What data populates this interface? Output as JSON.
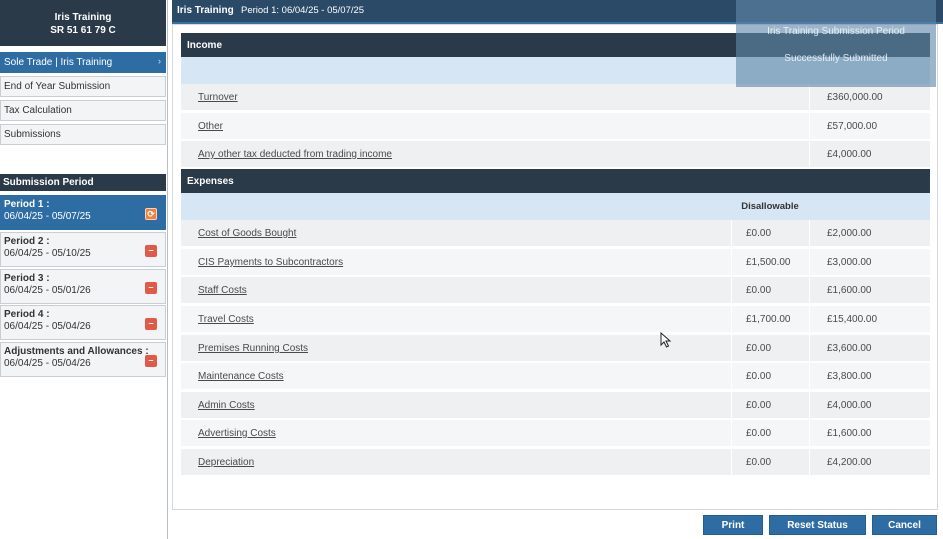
{
  "client": {
    "name": "Iris Training",
    "utr": "SR 51 61 79 C"
  },
  "nav": {
    "items": [
      {
        "label": "Sole Trade | Iris Training",
        "active": true
      },
      {
        "label": "End of Year Submission",
        "active": false
      },
      {
        "label": "Tax Calculation",
        "active": false
      },
      {
        "label": "Submissions",
        "active": false
      }
    ]
  },
  "submission_period": {
    "header": "Submission Period",
    "periods": [
      {
        "name": "Period 1 :",
        "dates": "06/04/25  -  05/07/25",
        "active": true
      },
      {
        "name": "Period 2 :",
        "dates": "06/04/25  -  05/10/25",
        "active": false
      },
      {
        "name": "Period 3 :",
        "dates": "06/04/25  -  05/01/26",
        "active": false
      },
      {
        "name": "Period 4 :",
        "dates": "06/04/25  -  05/04/26",
        "active": false
      },
      {
        "name": "Adjustments and Allowances :",
        "dates": "06/04/25  -  05/04/26",
        "active": false
      }
    ]
  },
  "topbar": {
    "org": "Iris Training",
    "period_label": "Period 1: 06/04/25 - 05/07/25"
  },
  "toast": {
    "line1": "Iris Training Submission Period",
    "line2": "Successfully Submitted"
  },
  "income": {
    "header": "Income",
    "rows": [
      {
        "label": "Turnover",
        "amount": "£360,000.00"
      },
      {
        "label": "Other",
        "amount": "£57,000.00"
      },
      {
        "label": "Any other tax deducted from trading income",
        "amount": "£4,000.00"
      }
    ]
  },
  "expenses": {
    "header": "Expenses",
    "disallowable_label": "Disallowable",
    "rows": [
      {
        "label": "Cost of Goods Bought",
        "disallowable": "£0.00",
        "amount": "£2,000.00"
      },
      {
        "label": "CIS Payments to Subcontractors",
        "disallowable": "£1,500.00",
        "amount": "£3,000.00"
      },
      {
        "label": "Staff Costs",
        "disallowable": "£0.00",
        "amount": "£1,600.00"
      },
      {
        "label": "Travel Costs",
        "disallowable": "£1,700.00",
        "amount": "£15,400.00"
      },
      {
        "label": "Premises Running Costs",
        "disallowable": "£0.00",
        "amount": "£3,600.00"
      },
      {
        "label": "Maintenance Costs",
        "disallowable": "£0.00",
        "amount": "£3,800.00"
      },
      {
        "label": "Admin Costs",
        "disallowable": "£0.00",
        "amount": "£4,000.00"
      },
      {
        "label": "Advertising Costs",
        "disallowable": "£0.00",
        "amount": "£1,600.00"
      },
      {
        "label": "Depreciation",
        "disallowable": "£0.00",
        "amount": "£4,200.00"
      }
    ]
  },
  "buttons": {
    "print": "Print",
    "reset": "Reset Status",
    "cancel": "Cancel"
  },
  "colors": {
    "brand_dark": "#2b3a48",
    "accent": "#2e6da4",
    "status_submitted": "#f07f40",
    "status_pending": "#e05a48"
  },
  "icons": {
    "period_submitted": "refresh-icon",
    "period_pending": "minus-icon",
    "nav_active": "chevron-right-icon"
  }
}
